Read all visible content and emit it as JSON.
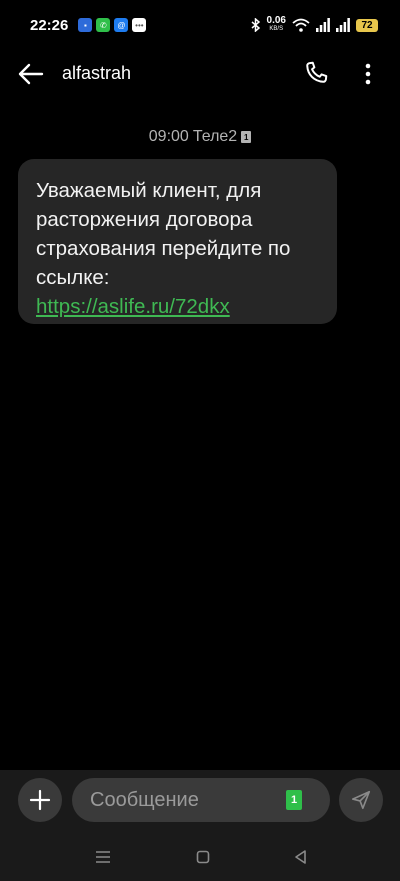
{
  "status_bar": {
    "time": "22:26",
    "net_speed_value": "0.06",
    "net_speed_unit": "KB/S",
    "battery": "72"
  },
  "header": {
    "contact_name": "alfastrah"
  },
  "message": {
    "time": "09:00",
    "carrier": "Теле2",
    "sim_number": "1",
    "text": "Уважаемый клиент, для расторжения договора страхования перейдите по ссылке:",
    "link": "https://aslife.ru/72dkx"
  },
  "composer": {
    "placeholder": "Сообщение",
    "sim_number": "1"
  },
  "colors": {
    "background": "#000000",
    "bubble": "#262626",
    "link": "#3fb953",
    "battery": "#e7c64c",
    "sim": "#2fbf4a"
  }
}
